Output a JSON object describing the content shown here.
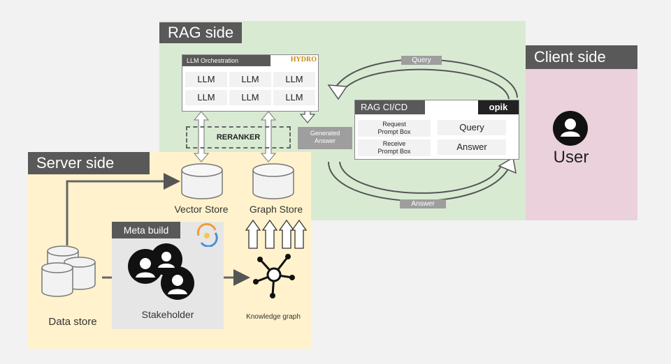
{
  "rag": {
    "title": "RAG side",
    "llm_orchestration": "LLM Orchestration",
    "hydro_logo": "HYDRO",
    "llm_cells": [
      "LLM",
      "LLM",
      "LLM",
      "LLM",
      "LLM",
      "LLM"
    ],
    "reranker": "RERANKER",
    "generated_answer_line1": "Generated",
    "generated_answer_line2": "Answer",
    "query_pill": "Query",
    "answer_pill": "Answer",
    "cicd": {
      "title": "RAG CI/CD",
      "opik_logo": "opik",
      "request_line1": "Request",
      "request_line2": "Prompt Box",
      "receive_line1": "Receive",
      "receive_line2": "Prompt Box",
      "query": "Query",
      "answer": "Answer"
    }
  },
  "client": {
    "title": "Client side",
    "user": "User"
  },
  "server": {
    "title": "Server side",
    "vector_store": "Vector Store",
    "graph_store": "Graph Store",
    "data_store": "Data store",
    "meta_build": "Meta build",
    "stakeholder": "Stakeholder",
    "knowledge_graph": "Knowledge graph"
  }
}
